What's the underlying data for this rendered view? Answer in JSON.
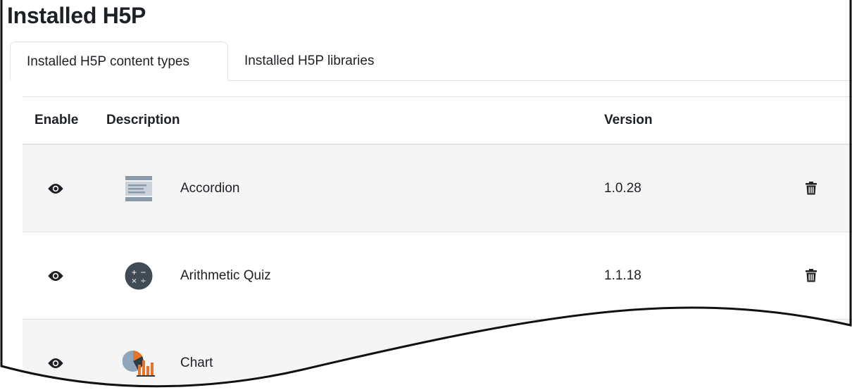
{
  "page": {
    "title": "Installed H5P"
  },
  "tabs": [
    {
      "label": "Installed H5P content types",
      "active": true
    },
    {
      "label": "Installed H5P libraries",
      "active": false
    }
  ],
  "table": {
    "headers": {
      "enable": "Enable",
      "description": "Description",
      "version": "Version"
    },
    "rows": [
      {
        "name": "Accordion",
        "version": "1.0.28",
        "icon": "accordion-icon"
      },
      {
        "name": "Arithmetic Quiz",
        "version": "1.1.18",
        "icon": "arithmetic-quiz-icon"
      },
      {
        "name": "Chart",
        "version": "",
        "icon": "chart-icon"
      }
    ]
  },
  "colors": {
    "row_alt": "#f5f5f6",
    "border": "#dee2e6",
    "text": "#1d2125"
  }
}
